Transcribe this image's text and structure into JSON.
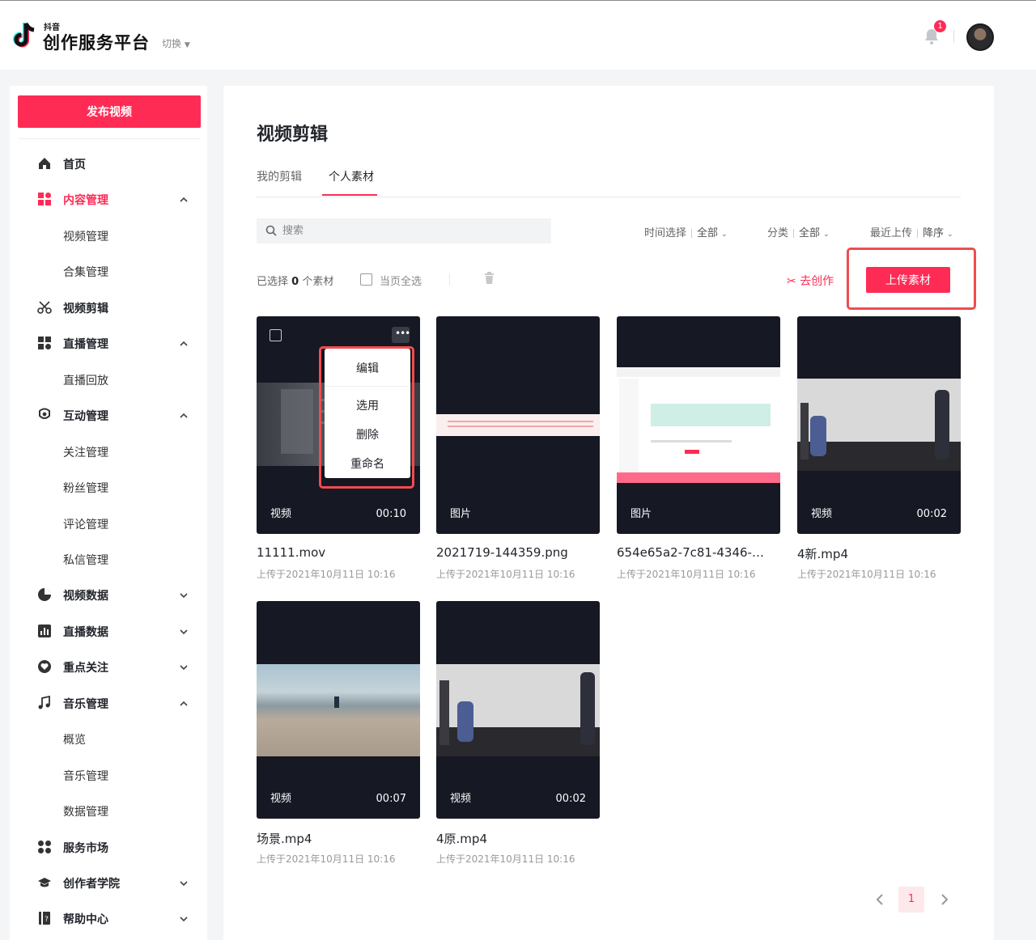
{
  "header": {
    "logo_small": "抖音",
    "logo_title": "创作服务平台",
    "switch_label": "切换",
    "notification_count": "1"
  },
  "sidebar": {
    "publish_label": "发布视频",
    "items": [
      {
        "label": "首页",
        "icon": "home-icon",
        "level": 0,
        "expanded": null,
        "active": false
      },
      {
        "label": "内容管理",
        "icon": "content-grid-icon",
        "level": 0,
        "expanded": true,
        "active": true
      },
      {
        "label": "视频管理",
        "level": 1
      },
      {
        "label": "合集管理",
        "level": 1
      },
      {
        "label": "视频剪辑",
        "icon": "scissors-icon",
        "level": 0,
        "expanded": null,
        "active": false
      },
      {
        "label": "直播管理",
        "icon": "live-grid-icon",
        "level": 0,
        "expanded": true,
        "active": false
      },
      {
        "label": "直播回放",
        "level": 1
      },
      {
        "label": "互动管理",
        "icon": "interaction-icon",
        "level": 0,
        "expanded": true,
        "active": false
      },
      {
        "label": "关注管理",
        "level": 1
      },
      {
        "label": "粉丝管理",
        "level": 1
      },
      {
        "label": "评论管理",
        "level": 1
      },
      {
        "label": "私信管理",
        "level": 1
      },
      {
        "label": "视频数据",
        "icon": "pie-chart-icon",
        "level": 0,
        "expanded": false,
        "active": false
      },
      {
        "label": "直播数据",
        "icon": "bar-chart-icon",
        "level": 0,
        "expanded": false,
        "active": false
      },
      {
        "label": "重点关注",
        "icon": "heart-icon",
        "level": 0,
        "expanded": false,
        "active": false
      },
      {
        "label": "音乐管理",
        "icon": "music-note-icon",
        "level": 0,
        "expanded": true,
        "active": false
      },
      {
        "label": "概览",
        "level": 1
      },
      {
        "label": "音乐管理",
        "level": 1
      },
      {
        "label": "数据管理",
        "level": 1
      },
      {
        "label": "服务市场",
        "icon": "apps-icon",
        "level": 0,
        "expanded": null,
        "active": false
      },
      {
        "label": "创作者学院",
        "icon": "graduation-cap-icon",
        "level": 0,
        "expanded": false,
        "active": false
      },
      {
        "label": "帮助中心",
        "icon": "help-book-icon",
        "level": 0,
        "expanded": false,
        "active": false
      }
    ]
  },
  "main": {
    "title": "视频剪辑",
    "tabs": [
      {
        "label": "我的剪辑",
        "active": false
      },
      {
        "label": "个人素材",
        "active": true
      }
    ],
    "search_placeholder": "搜索",
    "filters": [
      {
        "label": "时间选择",
        "value": "全部"
      },
      {
        "label": "分类",
        "value": "全部"
      },
      {
        "label": "最近上传",
        "value": "降序"
      }
    ],
    "selection": {
      "prefix": "已选择",
      "count": "0",
      "suffix": "个素材"
    },
    "select_all_label": "当页全选",
    "go_create_label": "去创作",
    "upload_label": "上传素材",
    "context_menu": [
      "编辑",
      "选用",
      "删除",
      "重命名"
    ],
    "assets": [
      {
        "type": "视频",
        "duration": "00:10",
        "name": "11111.mov",
        "date": "上传于2021年10月11日 10:16"
      },
      {
        "type": "图片",
        "duration": "",
        "name": "2021719-144359.png",
        "date": "上传于2021年10月11日 10:16"
      },
      {
        "type": "图片",
        "duration": "",
        "name": "654e65a2-7c81-4346-…",
        "date": "上传于2021年10月11日 10:16"
      },
      {
        "type": "视频",
        "duration": "00:02",
        "name": "4新.mp4",
        "date": "上传于2021年10月11日 10:16"
      },
      {
        "type": "视频",
        "duration": "00:07",
        "name": "场景.mp4",
        "date": "上传于2021年10月11日 10:16"
      },
      {
        "type": "视频",
        "duration": "00:02",
        "name": "4原.mp4",
        "date": "上传于2021年10月11日 10:16"
      }
    ],
    "pagination": {
      "current": "1"
    }
  },
  "colors": {
    "accent": "#fe2c55",
    "highlight": "#ef4c4f",
    "thumb_bg": "#161823"
  }
}
